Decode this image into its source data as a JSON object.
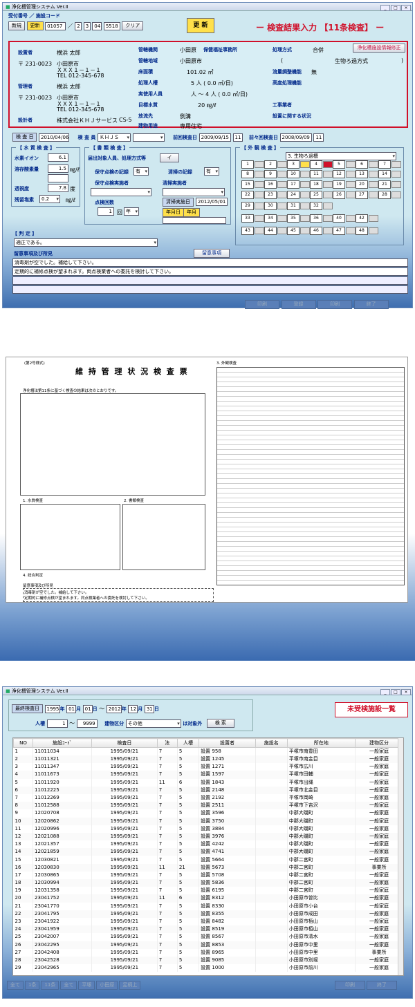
{
  "screen1": {
    "title": "浄化槽管理システム Ver.Ⅱ",
    "receipt_label": "受付番号 ／ 施設コード",
    "btn_new": "新規",
    "btn_update": "更新",
    "receipt_no": "01057",
    "facility_code": [
      "2",
      "3",
      "04",
      "5518"
    ],
    "btn_clear": "クリア",
    "btn_big_update": "更 新",
    "heading": "ー 検査結果入力 【11条検査】 ー",
    "info": {
      "setter_label": "設置者",
      "setter_name": "横浜 太郎",
      "setter_zip": "〒 231-0023",
      "setter_addr1": "小田原市",
      "setter_addr2": "ＸＸＸ１－１－１",
      "setter_tel": "TEL 012-345-678",
      "manager_label": "管理者",
      "manager_name": "横浜 太郎",
      "manager_zip": "〒 231-0023",
      "manager_addr1": "小田原市",
      "manager_addr2": "ＸＸＸ１－１－１",
      "manager_tel": "TEL 012-345-678",
      "designer_label": "設計者",
      "designer_name": "株式会社ＫＨＪサービス",
      "designer_cs": "CS-5",
      "org_label": "管轄機関",
      "org_value": "小田原",
      "hoken_label": "保健福祉事務所",
      "area_label": "管轄地域",
      "area_value": "小田原市",
      "floor_label": "床面積",
      "floor_value": "101.02 ㎡",
      "capacity_label": "処理人槽",
      "capacity_value": "5 人 ( 0.0 ㎥/日)",
      "users_label": "実使用人員",
      "users_value": "人 ～ 4 人 ( 0.0 ㎥/日)",
      "bod_label": "目標水質",
      "bod_value": "20 ㎎/ℓ",
      "discharge_label": "放流先",
      "discharge_value": "側溝",
      "bldg_label": "建物用途",
      "bldg_value": "専用住宅",
      "method_label": "処理方式",
      "method_value": "合併",
      "btn_facility_edit": "浄化槽施設情報修正",
      "method_detail": "生物ろ過方式",
      "flow_label": "流量調整機能",
      "flow_value": "無",
      "advanced_label": "高度処理機能",
      "contractor_label": "工事業者",
      "setup_label": "設置に関する状況"
    },
    "inspection_date_label": "検 査 日",
    "inspection_date": "2010/04/06",
    "inspector_label": "検 査 員",
    "inspector": "ＫＨＪＳ",
    "prev_label": "前回検査日",
    "prev_date": "2009/09/15",
    "prev_no": "11",
    "prev2_label": "前々回検査日",
    "prev2_date": "2008/09/09",
    "prev2_no": "11",
    "water_legend": "【 水 質 検 査 】",
    "hydrogen_label": "水素イオン",
    "hydrogen_value": "6.1",
    "do_label": "溶存酸素量",
    "do_value": "1.5",
    "do_unit": "㎎/ℓ",
    "clarity_label": "透視度",
    "clarity_value": "7.8",
    "clarity_unit": "度",
    "chlorine_label": "残留塩素",
    "chlorine_value": "0.2",
    "chlorine_unit": "㎎/ℓ",
    "doc_legend": "【 書 類 検 査 】",
    "doc_target_label": "届出対象人員、処理方式等",
    "doc_target_value": "イ",
    "maint_label": "保守点検の記録",
    "maint_value": "有",
    "clean_label": "清掃の記録",
    "clean_value": "有",
    "maint_firm_label": "保守点検実施者",
    "clean_firm_label": "清掃実施者",
    "points_label": "点検回数",
    "points_value": "1",
    "points_unit1": "回",
    "points_unit2": "年",
    "clean_date_label": "清掃実施日",
    "clean_date": "2012/05/01",
    "btn_ym": "年月日",
    "btn_y": "年月",
    "visual_legend": "【 外 観 検 査 】",
    "visual_select": "3. 生物ろ過槽",
    "judge_legend": "【 判 定 】",
    "judge_value": "適正である。",
    "notes_label": "留意事項及び所見",
    "btn_notes": "留意事項",
    "notes": [
      "消毒剤が空でした。補給して下さい。",
      "定期的に補修点検が望まれます。両点検業者への委託を検討して下さい。"
    ],
    "footer_btns": [
      "印刷",
      "登録",
      "印刷",
      "終了"
    ]
  },
  "screen2": {
    "form": "(第2号様式)",
    "title": "維 持 管 理 状 況 検 査 票",
    "sub1": "浄化槽法第11条に基づく検査の結果は次のとおりです。",
    "sec1": "1. 水質検査",
    "sec2": "2. 書類検査",
    "sec3": "3. 外観検査",
    "sec4": "4. 総合判定",
    "notes_title": "留意事項及び所見",
    "notes": [
      "消毒剤が空でした。補給して下さい。",
      "定期的に補修点検が望まれます。同点検業者への委託を検討して下さい。"
    ]
  },
  "screen3": {
    "title": "浄化槽管理システム Ver.Ⅱ",
    "last_date_label": "最終検査日",
    "from": [
      "1995",
      "01",
      "01"
    ],
    "to": [
      "2012",
      "12",
      "31"
    ],
    "y": "年",
    "m": "月",
    "d": "日",
    "tilde": "～",
    "capacity_label": "人槽",
    "cap_from": "1",
    "cap_to": "9999",
    "bldg_label": "建物区分",
    "bldg_value": "その他",
    "excluded": "は対象外",
    "btn_search": "検 索",
    "heading": "未受検施設一覧",
    "headers": [
      "NO",
      "施設ｺｰﾄﾞ",
      "検査日",
      "法",
      "人槽",
      "設置者",
      "施設名",
      "所在地",
      "建物区分"
    ],
    "rows": [
      [
        "1",
        "11011034",
        "1995/09/21",
        "7",
        "5",
        "設置 958",
        "",
        "平塚市南豊田",
        "一般家庭"
      ],
      [
        "2",
        "11011321",
        "1995/09/21",
        "7",
        "5",
        "設置 1245",
        "",
        "平塚市南金目",
        "一般家庭"
      ],
      [
        "3",
        "11011347",
        "1995/09/21",
        "7",
        "5",
        "設置 1271",
        "",
        "平塚市広川",
        "一般家庭"
      ],
      [
        "4",
        "11011673",
        "1995/09/21",
        "7",
        "5",
        "設置 1597",
        "",
        "平塚市田輔",
        "一般家庭"
      ],
      [
        "5",
        "11011920",
        "1995/09/21",
        "11",
        "6",
        "設置 1843",
        "",
        "平塚市出縄",
        "一般家庭"
      ],
      [
        "6",
        "11012225",
        "1995/09/21",
        "7",
        "5",
        "設置 2148",
        "",
        "平塚市北金目",
        "一般家庭"
      ],
      [
        "7",
        "11012269",
        "1995/09/21",
        "7",
        "5",
        "設置 2192",
        "",
        "平塚市岡崎",
        "一般家庭"
      ],
      [
        "8",
        "11012588",
        "1995/09/21",
        "7",
        "5",
        "設置 2511",
        "",
        "平塚市下吉沢",
        "一般家庭"
      ],
      [
        "9",
        "12020708",
        "1995/09/21",
        "7",
        "5",
        "設置 3596",
        "",
        "中郡大磯町",
        "一般家庭"
      ],
      [
        "10",
        "12020862",
        "1995/09/21",
        "7",
        "5",
        "設置 3750",
        "",
        "中郡大磯町",
        "一般家庭"
      ],
      [
        "11",
        "12020996",
        "1995/09/21",
        "7",
        "5",
        "設置 3884",
        "",
        "中郡大磯町",
        "一般家庭"
      ],
      [
        "12",
        "12021088",
        "1995/09/21",
        "7",
        "5",
        "設置 3976",
        "",
        "中郡大磯町",
        "一般家庭"
      ],
      [
        "13",
        "12021357",
        "1995/09/21",
        "7",
        "5",
        "設置 4242",
        "",
        "中郡大磯町",
        "一般家庭"
      ],
      [
        "14",
        "12021859",
        "1995/09/21",
        "7",
        "5",
        "設置 4741",
        "",
        "中郡大磯町",
        "一般家庭"
      ],
      [
        "15",
        "12030821",
        "1995/09/21",
        "7",
        "5",
        "設置 5664",
        "",
        "中郡二宮町",
        "一般家庭"
      ],
      [
        "16",
        "12030830",
        "1995/09/21",
        "11",
        "21",
        "設置 5673",
        "",
        "中郡二宮町",
        "事業所"
      ],
      [
        "17",
        "12030865",
        "1995/09/21",
        "7",
        "5",
        "設置 5708",
        "",
        "中郡二宮町",
        "一般家庭"
      ],
      [
        "18",
        "12030994",
        "1995/09/21",
        "7",
        "5",
        "設置 5836",
        "",
        "中郡二宮町",
        "一般家庭"
      ],
      [
        "19",
        "12031358",
        "1995/09/21",
        "7",
        "5",
        "設置 6195",
        "",
        "中郡二宮町",
        "一般家庭"
      ],
      [
        "20",
        "23041752",
        "1995/09/21",
        "11",
        "6",
        "設置 8312",
        "",
        "小田原市曽比",
        "一般家庭"
      ],
      [
        "21",
        "23041770",
        "1995/09/21",
        "7",
        "5",
        "設置 8330",
        "",
        "小田原市小台",
        "一般家庭"
      ],
      [
        "22",
        "23041795",
        "1995/09/21",
        "7",
        "5",
        "設置 8355",
        "",
        "小田原市成田",
        "一般家庭"
      ],
      [
        "23",
        "23041922",
        "1995/09/21",
        "7",
        "5",
        "設置 8482",
        "",
        "小田原市栢山",
        "一般家庭"
      ],
      [
        "24",
        "23041959",
        "1995/09/21",
        "7",
        "5",
        "設置 8519",
        "",
        "小田原市栢山",
        "一般家庭"
      ],
      [
        "25",
        "23042007",
        "1995/09/21",
        "7",
        "5",
        "設置 8567",
        "",
        "小田原市清水",
        "一般家庭"
      ],
      [
        "26",
        "23042295",
        "1995/09/21",
        "7",
        "5",
        "設置 8853",
        "",
        "小田原市中里",
        "一般家庭"
      ],
      [
        "27",
        "23042408",
        "1995/09/21",
        "7",
        "5",
        "設置 8965",
        "",
        "小田原市中里",
        "事業所"
      ],
      [
        "28",
        "23042528",
        "1995/09/21",
        "7",
        "5",
        "設置 9085",
        "",
        "小田原市別堀",
        "一般家庭"
      ],
      [
        "29",
        "23042965",
        "1995/09/21",
        "7",
        "5",
        "設置 1000",
        "",
        "小田原市前川",
        "一般家庭"
      ]
    ],
    "footer_left": [
      "全て",
      "1条",
      "11条",
      "全て",
      "平塚",
      "小田原",
      "足柄上"
    ],
    "footer_right": [
      "印刷",
      "終了"
    ]
  }
}
